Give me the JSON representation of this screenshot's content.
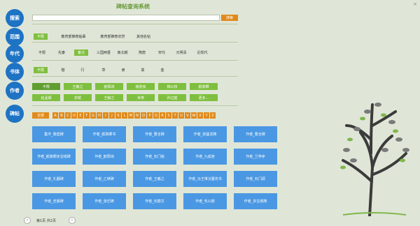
{
  "title": "碑帖查询系统",
  "close_label": "×",
  "sections": {
    "search": "搜索",
    "scope": "范围",
    "era": "年代",
    "font": "书体",
    "author": "作者",
    "tablet": "碑帖"
  },
  "search": {
    "placeholder": "",
    "button": "搜索"
  },
  "scope": [
    "不限",
    "教育部推荐临摹",
    "教育部推荐欣赏",
    "其他名帖"
  ],
  "era": [
    "不限",
    "先秦",
    "秦汉",
    "三国两晋",
    "南北朝",
    "隋唐",
    "宋代",
    "元明清",
    "近现代"
  ],
  "font": [
    "不限",
    "楷",
    "行",
    "草",
    "隶",
    "篆",
    "金"
  ],
  "authors_row1": [
    "不限",
    "王羲之",
    "欧阳询",
    "褚遂良",
    "柳公权",
    "颜真卿"
  ],
  "authors_row2": [
    "赵孟頫",
    "苏轼",
    "王献之",
    "米芾",
    "孙过庭",
    "更多..."
  ],
  "letters": [
    "全部",
    "A",
    "B",
    "C",
    "D",
    "E",
    "F",
    "G",
    "H",
    "I",
    "J",
    "K",
    "L",
    "M",
    "N",
    "O",
    "P",
    "Q",
    "R",
    "S",
    "T",
    "U",
    "V",
    "W",
    "X",
    "Y",
    "Z"
  ],
  "cards": [
    "集字_敦煌碑",
    "作者_颜真卿书",
    "作者_曹全碑",
    "作者_张猛龙碑",
    "作者_曹全碑",
    "作者_颜真卿多宝塔碑",
    "作者_欧阳询",
    "作者_石门铭",
    "作者_九成宫",
    "作者_兰亭序",
    "作者_礼器碑",
    "作者_乙瑛碑",
    "作者_王羲之",
    "作者_马王堆汉墓帛书",
    "作者_石门颂",
    "作者_史晨碑",
    "作者_张迁碑",
    "作者_石鼓文",
    "作者_毛公鼎",
    "作者_多宝塔碑"
  ],
  "pager": {
    "text": "第1页 共2页",
    "prev": "‹",
    "next": "›"
  }
}
